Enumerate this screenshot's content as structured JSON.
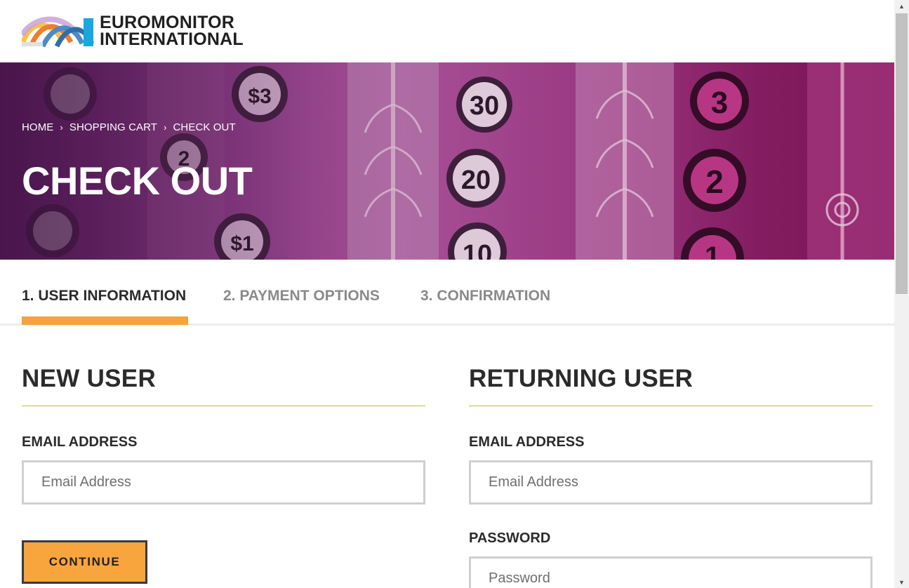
{
  "header": {
    "logo_line1": "EUROMONITOR",
    "logo_line2": "INTERNATIONAL"
  },
  "breadcrumb": {
    "items": [
      "HOME",
      "SHOPPING CART",
      "CHECK OUT"
    ],
    "separator": "›"
  },
  "hero": {
    "title": "CHECK OUT",
    "art_numbers": [
      "30",
      "20",
      "10",
      "3",
      "2",
      "1",
      "$3",
      "$1",
      "2"
    ]
  },
  "steps": [
    {
      "label": "1. USER INFORMATION",
      "active": true
    },
    {
      "label": "2. PAYMENT OPTIONS",
      "active": false
    },
    {
      "label": "3. CONFIRMATION",
      "active": false
    }
  ],
  "new_user": {
    "title": "NEW USER",
    "email_label": "EMAIL ADDRESS",
    "email_placeholder": "Email Address",
    "email_value": "",
    "continue_label": "CONTINUE"
  },
  "returning_user": {
    "title": "RETURNING USER",
    "email_label": "EMAIL ADDRESS",
    "email_placeholder": "Email Address",
    "email_value": "",
    "password_label": "PASSWORD",
    "password_placeholder": "Password",
    "password_value": ""
  },
  "colors": {
    "accent": "#f5a33c",
    "hero_purple": "#8a3c86",
    "divider_gold": "#c4b44a"
  },
  "icons": {
    "breadcrumb_separator": "chevron-right-icon",
    "scroll_up": "arrow-up-icon",
    "scroll_down": "arrow-down-icon"
  }
}
